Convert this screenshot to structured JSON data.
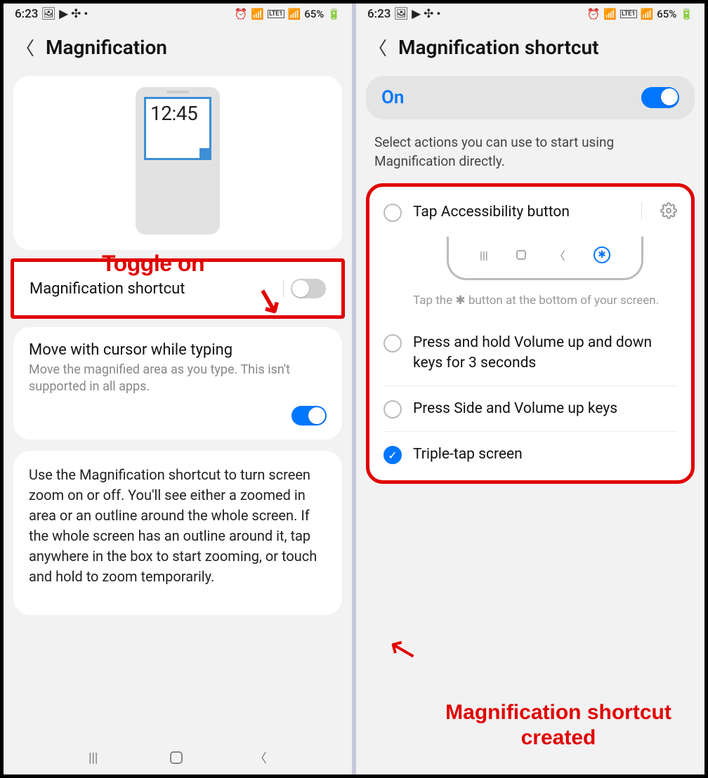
{
  "statusbar": {
    "time": "6:23",
    "battery": "65%",
    "lte": "LTE1"
  },
  "left": {
    "title": "Magnification",
    "mock_time": "12:45",
    "shortcut_row": "Magnification shortcut",
    "cursor_title": "Move with cursor while typing",
    "cursor_sub": "Move the magnified area as you type. This isn't supported in all apps.",
    "desc": "Use the Magnification shortcut to turn screen zoom on or off. You'll see either a zoomed in area or an outline around the whole screen. If the whole screen has an outline around it, tap anywhere in the box to start zooming, or touch and hold to zoom temporarily.",
    "anno": "Toggle on"
  },
  "right": {
    "title": "Magnification shortcut",
    "on_label": "On",
    "select_text": "Select actions you can use to start using Magnification directly.",
    "opt1": "Tap Accessibility button",
    "hint_pre": "Tap the ",
    "hint_post": " button at the bottom of your screen.",
    "opt2": "Press and hold Volume up and down keys for 3 seconds",
    "opt3": "Press Side and Volume up keys",
    "opt4": "Triple-tap screen",
    "anno": "Magnification shortcut created"
  }
}
